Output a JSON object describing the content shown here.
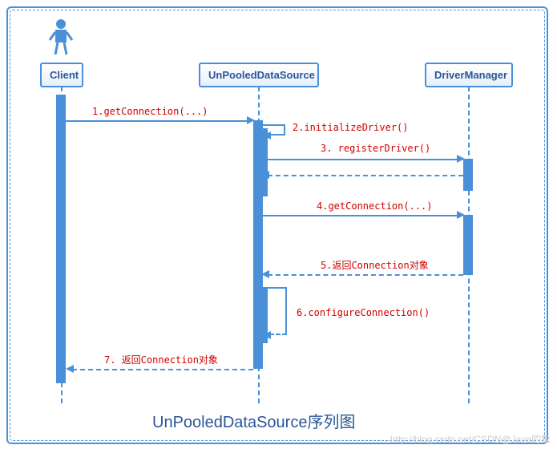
{
  "participants": {
    "client": "Client",
    "datasource": "UnPooledDataSource",
    "drivermanager": "DriverManager"
  },
  "messages": {
    "m1": "1.getConnection(...)",
    "m2": "2.initializeDriver()",
    "m3": "3. registerDriver()",
    "m4": "4.getConnection(...)",
    "m5": "5.返回Connection对象",
    "m6": "6.configureConnection()",
    "m7": "7. 返回Connection对象"
  },
  "title": "UnPooledDataSource序列图",
  "watermark": "http://blog.csdn.net/CSDN@Java的象",
  "chart_data": {
    "type": "sequence_diagram",
    "actors": [
      "Client"
    ],
    "participants": [
      "Client",
      "UnPooledDataSource",
      "DriverManager"
    ],
    "messages": [
      {
        "from": "Client",
        "to": "UnPooledDataSource",
        "label": "1.getConnection(...)",
        "type": "call"
      },
      {
        "from": "UnPooledDataSource",
        "to": "UnPooledDataSource",
        "label": "2.initializeDriver()",
        "type": "self"
      },
      {
        "from": "UnPooledDataSource",
        "to": "DriverManager",
        "label": "3. registerDriver()",
        "type": "call"
      },
      {
        "from": "DriverManager",
        "to": "UnPooledDataSource",
        "label": "",
        "type": "return"
      },
      {
        "from": "UnPooledDataSource",
        "to": "DriverManager",
        "label": "4.getConnection(...)",
        "type": "call"
      },
      {
        "from": "DriverManager",
        "to": "UnPooledDataSource",
        "label": "5.返回Connection对象",
        "type": "return"
      },
      {
        "from": "UnPooledDataSource",
        "to": "UnPooledDataSource",
        "label": "6.configureConnection()",
        "type": "self"
      },
      {
        "from": "UnPooledDataSource",
        "to": "Client",
        "label": "7. 返回Connection对象",
        "type": "return"
      }
    ],
    "title": "UnPooledDataSource序列图"
  }
}
